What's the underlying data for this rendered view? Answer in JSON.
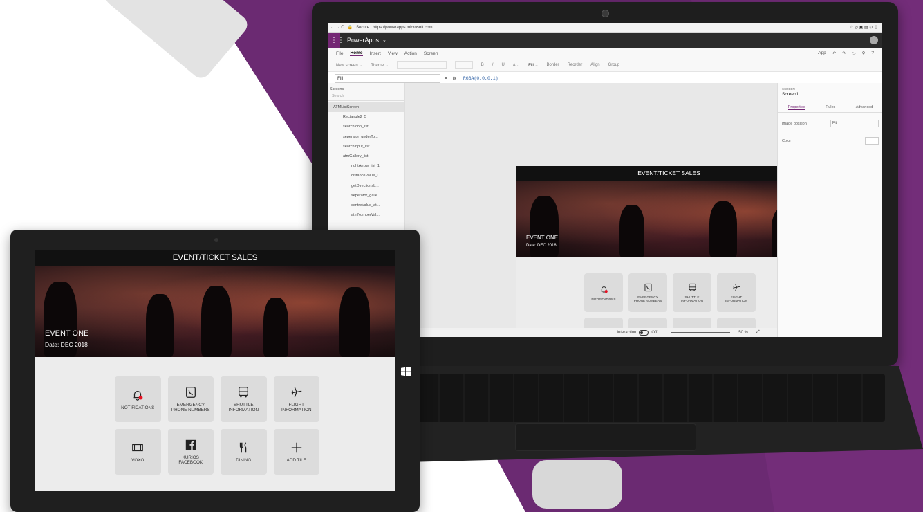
{
  "browser": {
    "nav": "← → C",
    "secure_label": "Secure",
    "url": "https://powerapps.microsoft.com",
    "icons": "☆ ◎ ▣ ▤ ⊙ ⋮"
  },
  "app_bar": {
    "waffle": "⋮⋮⋮",
    "name": "PowerApps",
    "chevron": "⌄"
  },
  "menu": {
    "items": [
      "File",
      "Home",
      "Insert",
      "View",
      "Action",
      "Screen"
    ],
    "right": [
      "App",
      "↶",
      "↷",
      "▷",
      "⚲",
      "?"
    ]
  },
  "ribbon": {
    "items": [
      "New screen ⌄",
      "Theme ⌄",
      "B",
      "/",
      "U",
      "A ⌄",
      "Fill ⌄",
      "Border",
      "Reorder",
      "Align",
      "Group"
    ]
  },
  "formula_bar": {
    "property": "Fill",
    "equals": "=",
    "fx": "fx",
    "value": "RGBA(0,0,0,1)"
  },
  "tree": {
    "title": "Screens",
    "search_placeholder": "Search",
    "items": [
      "ATMListScreen",
      "Rectangle2_5",
      "searchIcon_list",
      "seperator_underTo...",
      "searchInput_list",
      "atmGallery_list",
      "rightArrow_list_1",
      "distanceValue_l...",
      "getDirectionsL...",
      "seperator_galle...",
      "centreValue_at...",
      "atmNumberVal..."
    ]
  },
  "right_pane": {
    "section": "SCREEN",
    "name": "Screen1",
    "tabs": [
      "Properties",
      "Rules",
      "Advanced"
    ],
    "image_position_label": "Image position",
    "image_position_value": "Fit",
    "color_label": "Color"
  },
  "status_bar": {
    "screen": "creen1",
    "interaction_label": "Interaction",
    "toggle_state": "Off",
    "zoom": "50 %"
  },
  "app_preview": {
    "title": "EVENT/TICKET SALES",
    "event_name": "EVENT ONE",
    "event_date": "Date: DEC 2018",
    "tiles": [
      {
        "icon": "bell-icon",
        "line1": "NOTIFICATIONS",
        "line2": ""
      },
      {
        "icon": "phone-icon",
        "line1": "EMERGENCY",
        "line2": "PHONE NUMBERS"
      },
      {
        "icon": "bus-icon",
        "line1": "SHUTTLE",
        "line2": "INFORMATION"
      },
      {
        "icon": "plane-icon",
        "line1": "FLIGHT",
        "line2": "INFORMATION"
      },
      {
        "icon": "film-icon",
        "line1": "VOXO",
        "line2": ""
      },
      {
        "icon": "facebook-icon",
        "line1": "KURIOS",
        "line2": "FACEBOOK"
      },
      {
        "icon": "fork-knife-icon",
        "line1": "DINING",
        "line2": ""
      },
      {
        "icon": "plus-icon",
        "line1": "ADD TILE",
        "line2": ""
      }
    ]
  },
  "colors": {
    "brand": "#742774",
    "background_purple": "#6b2a72",
    "notification_dot": "#e81123"
  }
}
